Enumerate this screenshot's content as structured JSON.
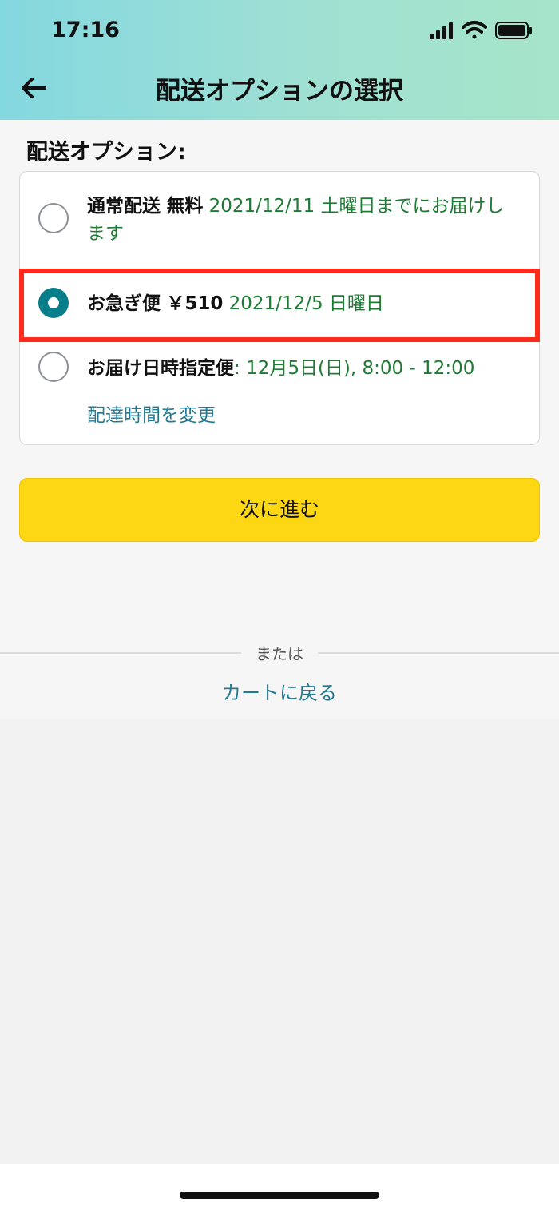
{
  "status_bar": {
    "time": "17:16"
  },
  "header": {
    "title": "配送オプションの選択"
  },
  "section_label": "配送オプション:",
  "options": [
    {
      "name": "通常配送",
      "price": "無料",
      "date": "2021/12/11 土曜日までにお届けします",
      "selected": false
    },
    {
      "name": "お急ぎ便",
      "price": "￥510",
      "date": "2021/12/5 日曜日",
      "selected": true
    },
    {
      "name": "お届け日時指定便",
      "price": "",
      "date": ": 12月5日(日), 8:00 - 12:00",
      "selected": false
    }
  ],
  "change_time_link": "配達時間を変更",
  "next_button": "次に進む",
  "divider_text": "または",
  "back_to_cart_link": "カートに戻る",
  "colors": {
    "accent_teal": "#087e8b",
    "button_yellow": "#fdd614",
    "highlight_red": "#ff2a1a",
    "date_green": "#1e7b34",
    "link_blue": "#227a92"
  }
}
